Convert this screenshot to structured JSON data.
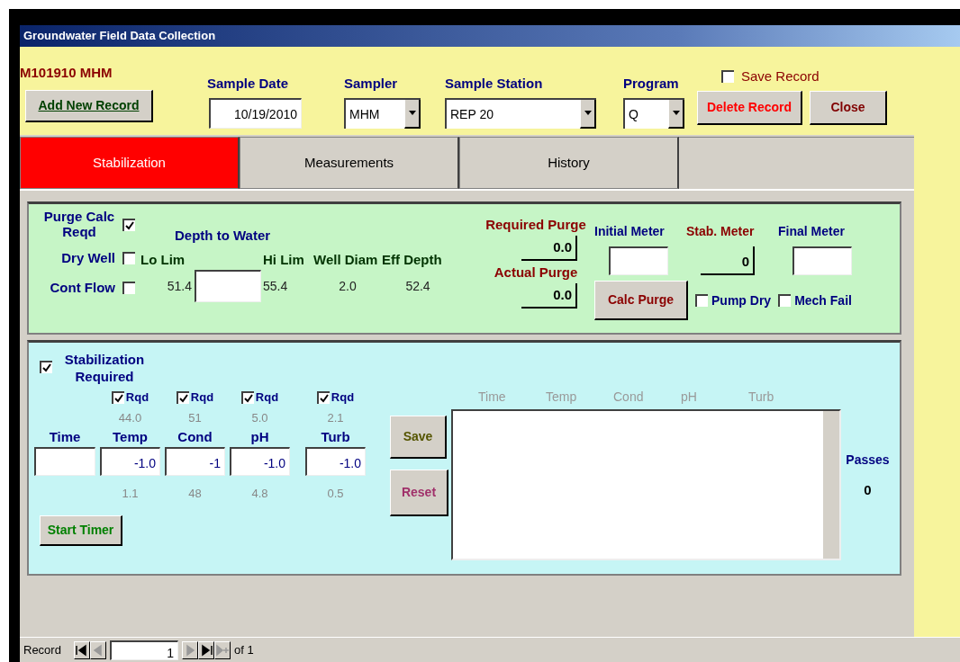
{
  "window": {
    "title": "Groundwater Field Data Collection"
  },
  "header": {
    "record_id": "M101910 MHM",
    "add_button": "Add New Record",
    "sample_date": {
      "label": "Sample Date",
      "value": "10/19/2010"
    },
    "sampler": {
      "label": "Sampler",
      "value": "MHM"
    },
    "sample_station": {
      "label": "Sample Station",
      "value": "REP 20"
    },
    "program": {
      "label": "Program",
      "value": "Q"
    },
    "save_record": {
      "label": "Save Record",
      "checked": false
    },
    "buttons": [
      {
        "label": "Delete Record",
        "kind": "danger"
      },
      {
        "label": "Close",
        "kind": "normal"
      }
    ]
  },
  "tabs": [
    {
      "label": "Stabilization",
      "selected": true
    },
    {
      "label": "Measurements",
      "selected": false
    },
    {
      "label": "History",
      "selected": false
    }
  ],
  "purge": {
    "flags": [
      {
        "label": "Purge Calc Reqd",
        "checked": true
      },
      {
        "label": "Dry Well",
        "checked": false
      },
      {
        "label": "Cont Flow",
        "checked": false
      }
    ],
    "depth_title": "Depth to Water",
    "lo_lim": {
      "label": "Lo Lim",
      "value": "51.4"
    },
    "hi_lim": {
      "label": "Hi Lim",
      "value": "55.4"
    },
    "well_diam": {
      "label": "Well Diam",
      "value": "2.0"
    },
    "eff_depth": {
      "label": "Eff Depth",
      "value": "52.4"
    },
    "required_purge": {
      "label": "Required Purge",
      "value": "0.0"
    },
    "actual_purge": {
      "label": "Actual Purge",
      "value": "0.0"
    },
    "meters": [
      {
        "label": "Initial Meter",
        "kind": "input"
      },
      {
        "label": "Stab. Meter",
        "kind": "computed",
        "value": "0"
      },
      {
        "label": "Final Meter",
        "kind": "input"
      }
    ],
    "calc_button": "Calc Purge",
    "checks": [
      {
        "label": "Pump Dry",
        "checked": false
      },
      {
        "label": "Mech Fail",
        "checked": false
      }
    ]
  },
  "stabilization": {
    "required": {
      "label": "Stabilization Required",
      "checked": true
    },
    "params": [
      {
        "label": "Time"
      },
      {
        "label": "Temp",
        "rqd": {
          "label": "Rqd",
          "checked": true
        },
        "upper": "44.0",
        "value": "-1.0",
        "lower": "1.1"
      },
      {
        "label": "Cond",
        "rqd": {
          "label": "Rqd",
          "checked": true
        },
        "upper": "51",
        "value": "-1",
        "lower": "48"
      },
      {
        "label": "pH",
        "rqd": {
          "label": "Rqd",
          "checked": true
        },
        "upper": "5.0",
        "value": "-1.0",
        "lower": "4.8"
      },
      {
        "label": "Turb",
        "rqd": {
          "label": "Rqd",
          "checked": true
        },
        "upper": "2.1",
        "value": "-1.0",
        "lower": "0.5"
      }
    ],
    "start_button": "Start Timer",
    "save_button": "Save",
    "reset_button": "Reset",
    "log_columns": [
      "Time",
      "Temp",
      "Cond",
      "pH",
      "Turb"
    ],
    "passes": {
      "label": "Passes",
      "value": "0"
    }
  },
  "navigation": {
    "label": "Record",
    "current": "1",
    "total": "of 1",
    "buttons": [
      {
        "kind": "first",
        "disabled": false
      },
      {
        "kind": "previous",
        "disabled": true
      },
      {
        "kind": "next",
        "disabled": true
      },
      {
        "kind": "last",
        "disabled": false
      },
      {
        "kind": "new",
        "disabled": true
      }
    ]
  }
}
